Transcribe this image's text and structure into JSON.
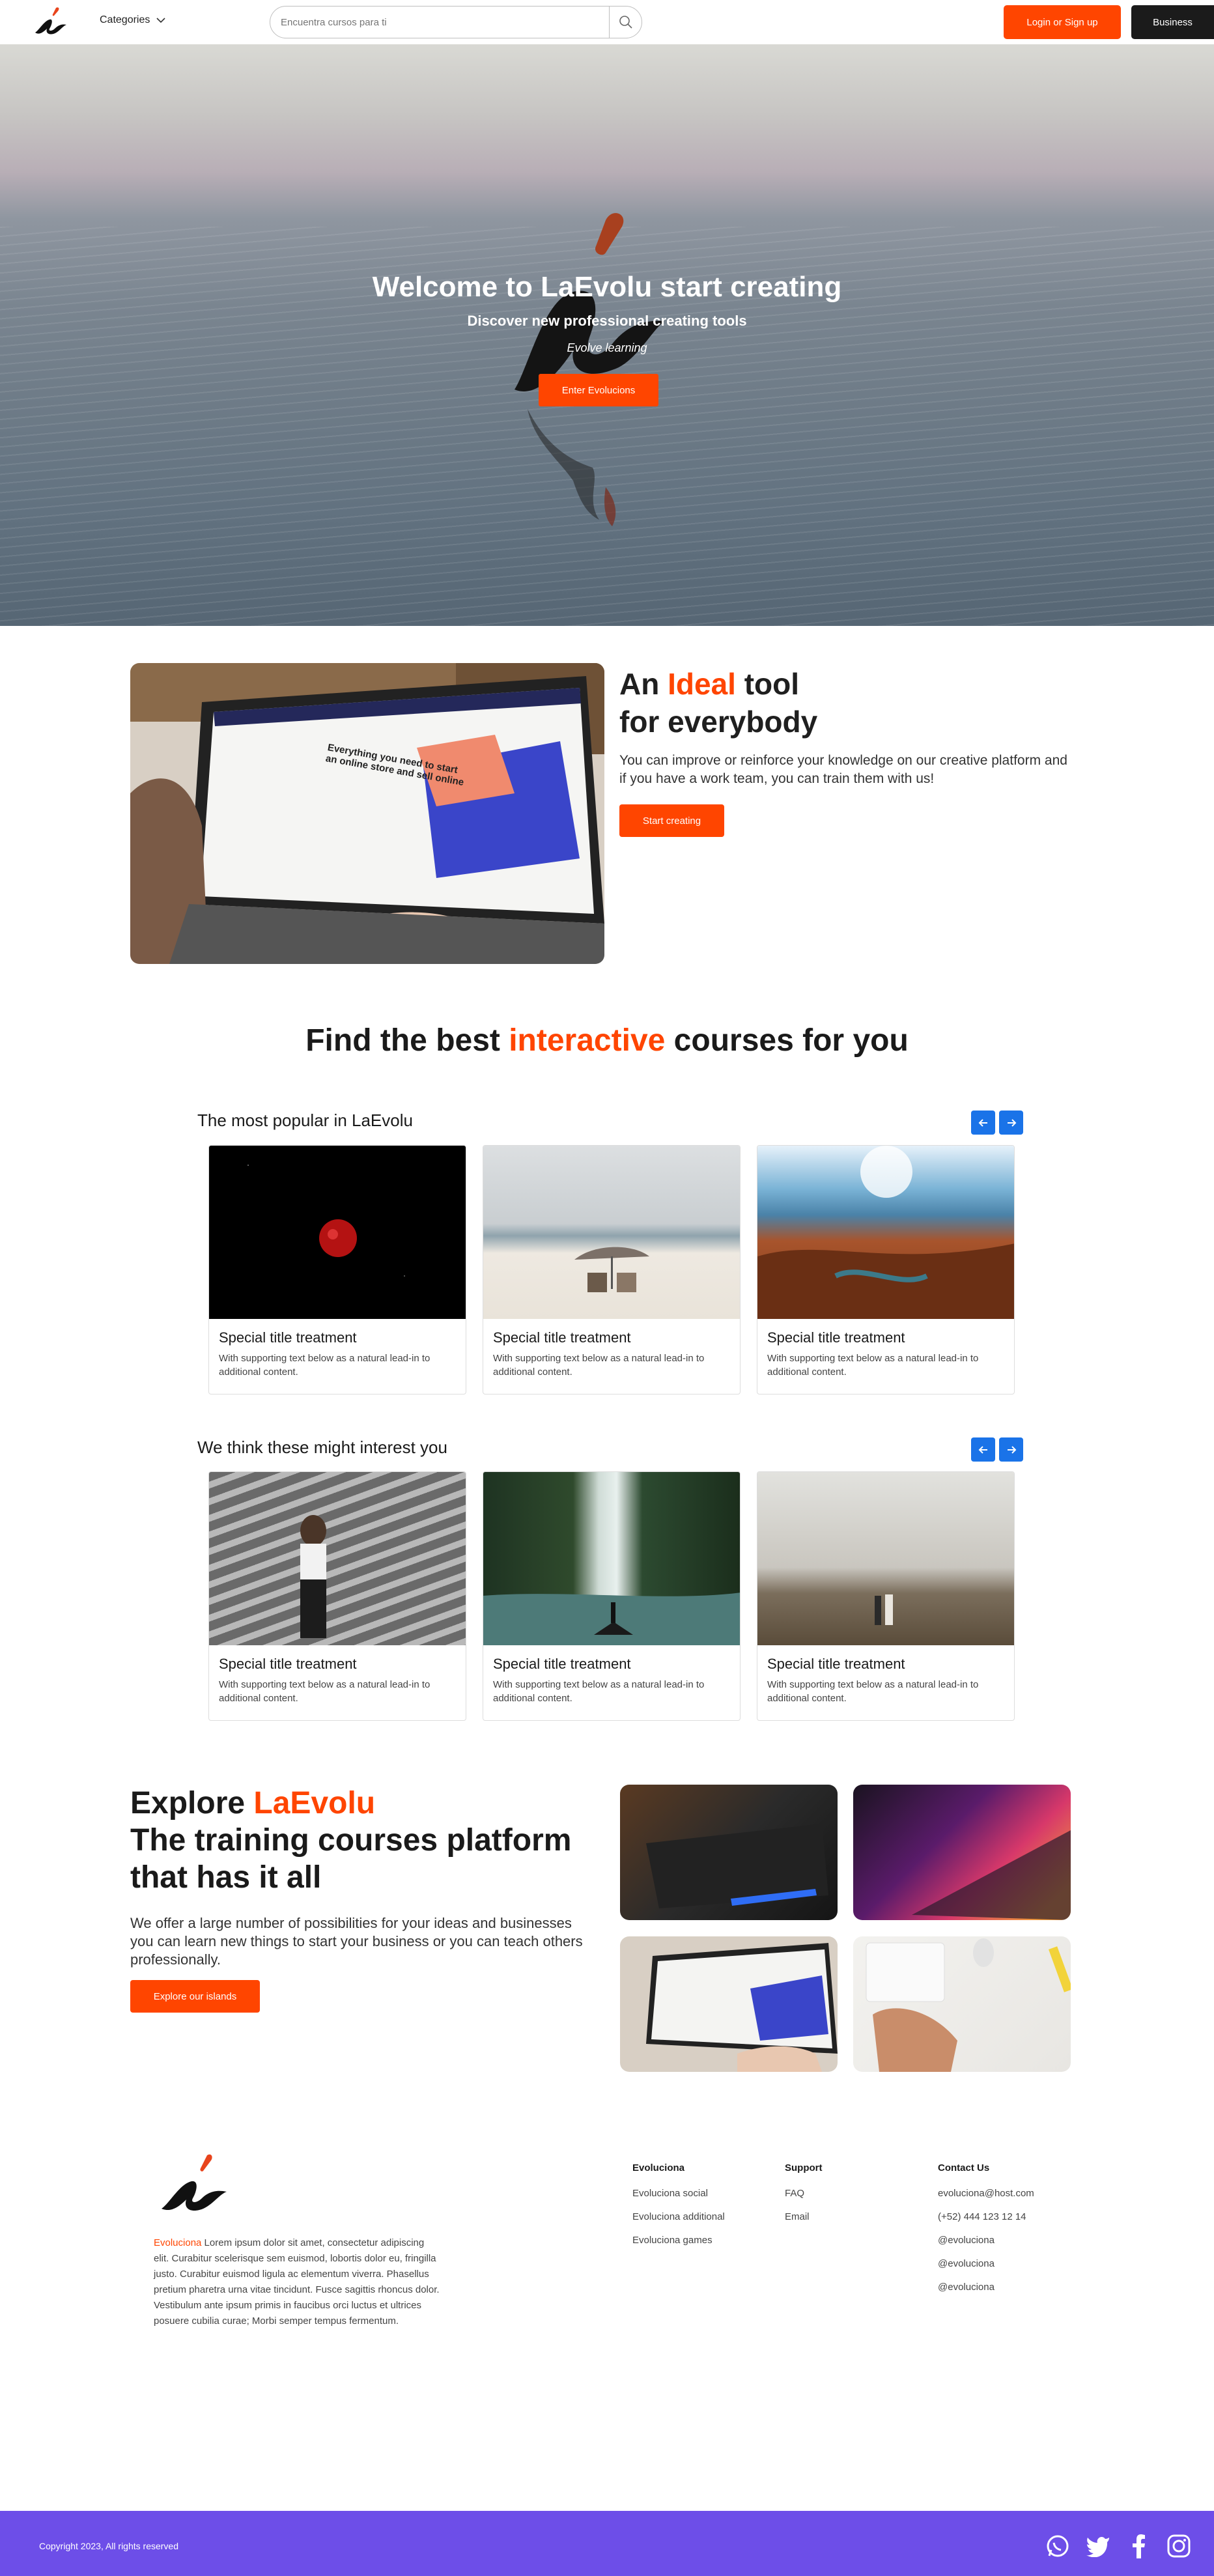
{
  "nav": {
    "categories_label": "Categories",
    "search_placeholder": "Encuentra cursos para ti",
    "login_label": "Login or Sign up",
    "business_label": "Business"
  },
  "hero": {
    "title": "Welcome to LaEvolu start creating",
    "subtitle": "Discover new professional creating tools",
    "tagline": "Evolve learning",
    "button_label": "Enter Evolucions"
  },
  "ideal": {
    "heading_pre": "An ",
    "heading_accent": "Ideal",
    "heading_post": " tool",
    "heading_line2": "for everybody",
    "text": "You can improve or reinforce your knowledge on our creative platform and if you have a work team, you can train them with us!",
    "button_label": "Start creating",
    "screen_text": "Everything you need to start an online store and sell online"
  },
  "find": {
    "pre": "Find the best ",
    "accent": "interactive",
    "post": " courses for you"
  },
  "popular": {
    "heading": "The most popular in LaEvolu",
    "cards": [
      {
        "title": "Special title treatment",
        "text": "With supporting text below as a natural lead-in to additional content."
      },
      {
        "title": "Special title treatment",
        "text": "With supporting text below as a natural lead-in to additional content."
      },
      {
        "title": "Special title treatment",
        "text": "With supporting text below as a natural lead-in to additional content."
      }
    ]
  },
  "interest": {
    "heading": "We think these might interest you",
    "cards": [
      {
        "title": "Special title treatment",
        "text": "With supporting text below as a natural lead-in to additional content."
      },
      {
        "title": "Special title treatment",
        "text": "With supporting text below as a natural lead-in to additional content."
      },
      {
        "title": "Special title treatment",
        "text": "With supporting text below as a natural lead-in to additional content."
      }
    ]
  },
  "explore": {
    "pre": "Explore ",
    "accent": "LaEvolu",
    "line2": "The training courses platform",
    "line3": "that has it all",
    "text": "We offer a large number of possibilities for your ideas and businesses you can learn new things to start your business or you can teach others professionally.",
    "button_label": "Explore our islands"
  },
  "footer": {
    "brand": "Evoluciona",
    "about": " Lorem ipsum dolor sit amet, consectetur adipiscing elit. Curabitur scelerisque sem euismod, lobortis dolor eu, fringilla justo. Curabitur euismod ligula ac elementum viverra. Phasellus pretium pharetra urna vitae tincidunt. Fusce sagittis rhoncus dolor. Vestibulum ante ipsum primis in faucibus orci luctus et ultrices posuere cubilia curae; Morbi semper tempus fermentum.",
    "col1": {
      "title": "Evoluciona",
      "links": [
        "Evoluciona social",
        "Evoluciona additional",
        "Evoluciona games"
      ]
    },
    "col2": {
      "title": "Support",
      "links": [
        "FAQ",
        "Email"
      ]
    },
    "col3": {
      "title": "Contact Us",
      "links": [
        "evoluciona@host.com",
        "(+52) 444 123 12 14",
        "@evoluciona",
        "@evoluciona",
        "@evoluciona"
      ]
    },
    "copyright": "Copyright 2023, All rights reserved",
    "socials": [
      "whatsapp-icon",
      "twitter-icon",
      "facebook-icon",
      "instagram-icon"
    ]
  },
  "colors": {
    "accent": "#ff4500",
    "dark": "#1b1b1b",
    "footer_bar": "#6d4ee8",
    "arrow_blue": "#1a73e8"
  }
}
